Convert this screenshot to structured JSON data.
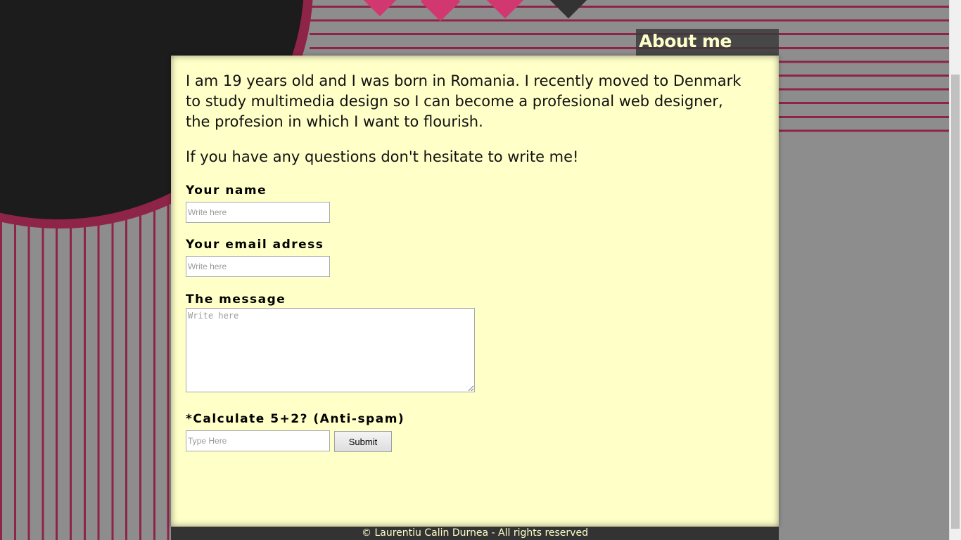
{
  "header": {
    "tab_title": "About me"
  },
  "bio": {
    "paragraph": "I am 19 years old and I was born in Romania. I recently moved to Denmark to study multimedia design so I can become a profesional web designer, the profesion in which I want to flourish.",
    "cta": "If you have any questions don't hesitate to write me!"
  },
  "form": {
    "name_label": "Your name",
    "name_placeholder": "Write here",
    "email_label": "Your email adress",
    "email_placeholder": "Write here",
    "message_label": "The message",
    "message_placeholder": "Write here",
    "captcha_label": "*Calculate 5+2? (Anti-spam)",
    "captcha_placeholder": "Type Here",
    "submit_label": "Submit"
  },
  "footer": {
    "text": "© Laurentiu Calin Durnea - All rights reserved"
  },
  "colors": {
    "panel_bg": "#ffffc8",
    "accent": "#8e2448",
    "pink": "#d23870",
    "dark": "#1c1c1c",
    "footer_bg": "#333333"
  }
}
